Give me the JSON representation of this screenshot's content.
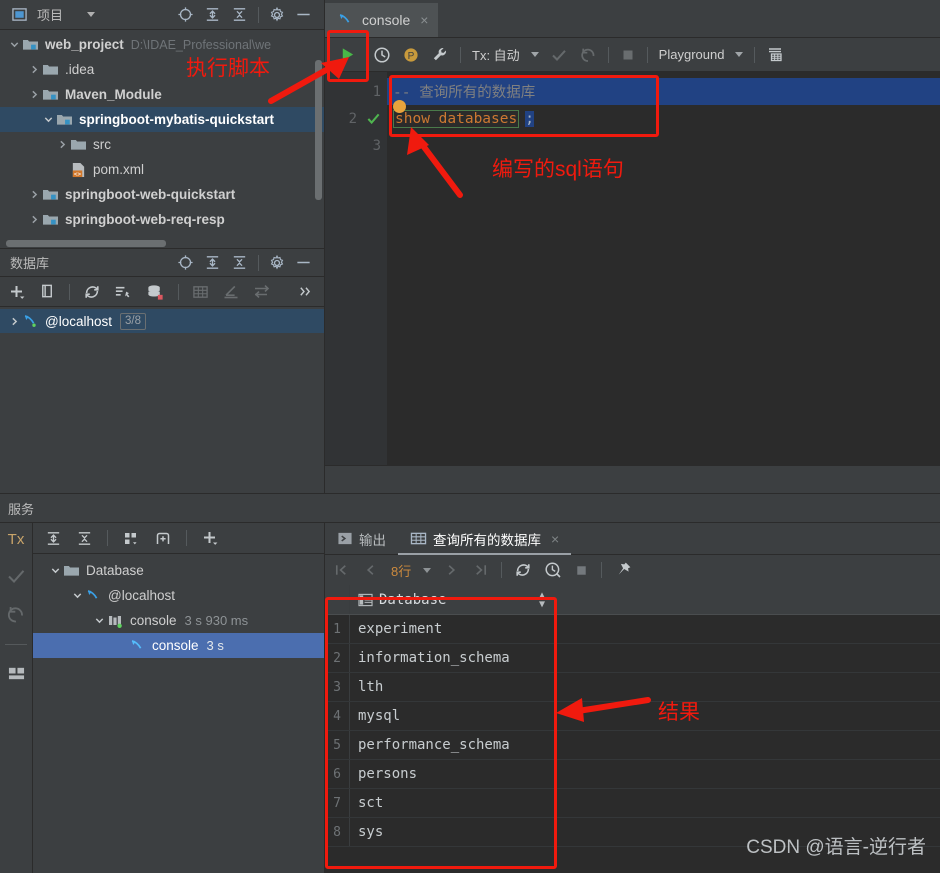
{
  "project": {
    "title": "项目",
    "tree": [
      {
        "label": "web_project",
        "path": "D:\\IDAE_Professional\\we",
        "icon": "module-folder-icon",
        "twist": "expanded",
        "indent": 0,
        "selected": false
      },
      {
        "label": ".idea",
        "path": "",
        "icon": "folder-icon",
        "twist": "collapsed",
        "indent": 1,
        "selected": false
      },
      {
        "label": "Maven_Module",
        "path": "",
        "icon": "module-folder-icon",
        "twist": "collapsed",
        "indent": 1,
        "selected": false
      },
      {
        "label": "springboot-mybatis-quickstart",
        "path": "",
        "icon": "module-folder-icon",
        "twist": "expanded",
        "indent": 1,
        "selected": true
      },
      {
        "label": "src",
        "path": "",
        "icon": "folder-icon",
        "twist": "collapsed",
        "indent": 2,
        "selected": false
      },
      {
        "label": "pom.xml",
        "path": "",
        "icon": "maven-xml-icon",
        "twist": "none",
        "indent": 2,
        "selected": false
      },
      {
        "label": "springboot-web-quickstart",
        "path": "",
        "icon": "module-folder-icon",
        "twist": "collapsed",
        "indent": 1,
        "selected": false
      },
      {
        "label": "springboot-web-req-resp",
        "path": "",
        "icon": "module-folder-icon",
        "twist": "collapsed",
        "indent": 1,
        "selected": false
      }
    ]
  },
  "database_panel": {
    "title": "数据库",
    "toolbar": [
      "add-icon",
      "copy-icon",
      "refresh-icon",
      "run-sql-icon",
      "datasource-props-icon",
      "table-icon",
      "edit-icon",
      "sync-icon",
      "more-icon"
    ],
    "tree": [
      {
        "label": "@localhost",
        "badge": "3/8",
        "icon": "mysql-icon",
        "selected": true
      }
    ]
  },
  "editor": {
    "tab": {
      "label": "console",
      "icon": "mysql-icon",
      "close": "×"
    },
    "toolbar": {
      "run": "run-icon",
      "history": "history-icon",
      "profile": "profile-icon",
      "wrench": "wrench-icon",
      "tx_label": "Tx: 自动",
      "commit": "commit-icon",
      "rollback": "rollback-icon",
      "stop": "stop-icon",
      "schema_label": "Playground",
      "grid_icon": "output-format-icon"
    },
    "lines": [
      {
        "num": "1",
        "marker": "",
        "text": "--  查询所有的数据库",
        "type": "comment",
        "highlighted": true
      },
      {
        "num": "2",
        "marker": "check",
        "text": "show databases ;",
        "type": "sql",
        "highlighted": false
      },
      {
        "num": "3",
        "marker": "",
        "text": "",
        "type": "empty",
        "highlighted": false
      }
    ],
    "sql_keyword": "show databases",
    "sql_semicolon": ";"
  },
  "services": {
    "bar_title": "服务",
    "rail": [
      "Tx-icon",
      "commit-icon",
      "rollback-icon",
      "layout-icon"
    ],
    "toolbar": [
      "expand-all-icon",
      "collapse-all-icon",
      "group-icon",
      "add-tab-icon",
      "add-icon"
    ],
    "tree": [
      {
        "label": "Database",
        "time": "",
        "icon": "folder-icon",
        "indent": 0,
        "twist": "expanded",
        "selected": false
      },
      {
        "label": "@localhost",
        "time": "",
        "icon": "mysql-icon",
        "indent": 1,
        "twist": "expanded",
        "selected": false
      },
      {
        "label": "console",
        "time": "3 s 930 ms",
        "icon": "console-run-icon",
        "indent": 2,
        "twist": "expanded",
        "selected": false
      },
      {
        "label": "console",
        "time": "3 s",
        "icon": "mysql-icon",
        "indent": 3,
        "twist": "none",
        "selected": true
      }
    ]
  },
  "results": {
    "tabs": [
      {
        "label": "输出",
        "icon": "output-icon",
        "active": false,
        "closable": false
      },
      {
        "label": "查询所有的数据库",
        "icon": "grid-icon",
        "active": true,
        "closable": true
      }
    ],
    "toolbar": {
      "first": "first-page-icon",
      "prev": "prev-page-icon",
      "rows_label": "8行",
      "next": "next-page-icon",
      "last": "last-page-icon",
      "reload": "reload-icon",
      "history": "query-history-icon",
      "stop": "stop-icon",
      "pin": "pin-icon"
    },
    "column_header": "Database",
    "rows": [
      {
        "n": "1",
        "value": "experiment"
      },
      {
        "n": "2",
        "value": "information_schema"
      },
      {
        "n": "3",
        "value": "lth"
      },
      {
        "n": "4",
        "value": "mysql"
      },
      {
        "n": "5",
        "value": "performance_schema"
      },
      {
        "n": "6",
        "value": "persons"
      },
      {
        "n": "7",
        "value": "sct"
      },
      {
        "n": "8",
        "value": "sys"
      }
    ]
  },
  "annotations": {
    "run_script": "执行脚本",
    "written_sql": "编写的sql语句",
    "result": "结果"
  },
  "watermark": "CSDN @语言-逆行者",
  "colors": {
    "accent_red": "#f01a0e",
    "selection_blue": "#2f4a63",
    "row_selected": "#4b6eaf",
    "code_keyword": "#cc7832",
    "panel_bg": "#3c3f41",
    "editor_bg": "#2b2b2b"
  }
}
